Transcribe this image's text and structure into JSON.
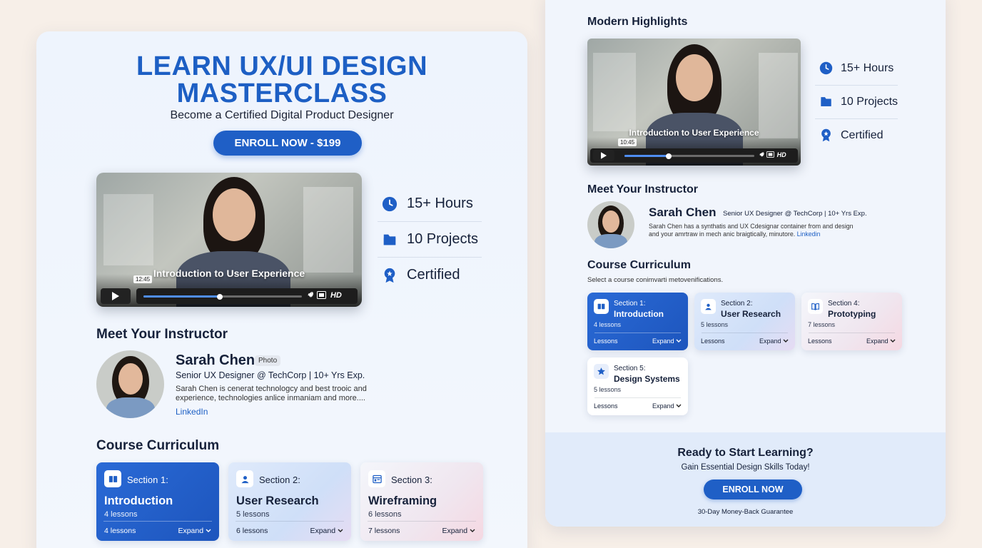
{
  "hero": {
    "title_line1": "LEARN UX/UI DESIGN",
    "title_line2": "MASTERCLASS",
    "subtitle": "Become a Certified Digital Product Designer",
    "enroll_label": "ENROLL NOW - $199"
  },
  "video": {
    "title": "Introduction to User Experience",
    "time": "12:45",
    "hd_label": "HD",
    "progress": 0.48
  },
  "stats": [
    {
      "icon": "clock-icon",
      "label": "15+ Hours"
    },
    {
      "icon": "folder-icon",
      "label": "10 Projects"
    },
    {
      "icon": "badge-icon",
      "label": "Certified"
    }
  ],
  "instructor": {
    "heading": "Meet Your Instructor",
    "name": "Sarah Chen",
    "photo_tag": "Photo",
    "role": "Senior UX Designer @ TechCorp | 10+ Yrs Exp.",
    "bio_line1": "Sarah Chen is cenerat technologcy and best trooic and",
    "bio_line2": "experience, technologies anlice inmaniam and more....",
    "link": "LinkedIn"
  },
  "curriculum": {
    "heading": "Course Curriculum",
    "sections": [
      {
        "section": "Section 1:",
        "title": "Introduction",
        "lessons": "4 lessons",
        "foot": "4 lessons",
        "expand": "Expand",
        "icon": "book-icon"
      },
      {
        "section": "Section 2:",
        "title": "User Research",
        "lessons": "5 lessons",
        "foot": "6 lessons",
        "expand": "Expand",
        "icon": "user-icon"
      },
      {
        "section": "Section 3:",
        "title": "Wireframing",
        "lessons": "6 lessons",
        "foot": "7 lessons",
        "expand": "Expand",
        "icon": "layout-icon"
      }
    ]
  },
  "right": {
    "highlights_heading": "Modern Highlights",
    "video": {
      "title": "Introduction to User Experience",
      "time": "10:45",
      "hd_label": "HD",
      "progress": 0.34
    },
    "stats": [
      {
        "icon": "clock-icon",
        "label": "15+ Hours"
      },
      {
        "icon": "folder-icon",
        "label": "10 Projects"
      },
      {
        "icon": "badge-icon",
        "label": "Certified"
      }
    ],
    "instructor": {
      "heading": "Meet Your Instructor",
      "name": "Sarah Chen",
      "role": "Senior UX Designer @ TechCorp | 10+ Yrs Exp.",
      "bio_line1": "Sarah Chen has a synthatis and UX Cdesignar container from and design",
      "bio_line2": "and your amrtraw in mech anic braigtically, minutore.",
      "link": "Linkedin"
    },
    "curriculum": {
      "heading": "Course Curriculum",
      "subtitle": "Select a course conimvarti metovenifications.",
      "sections": [
        {
          "section": "Section 1:",
          "title": "Introduction",
          "lessons": "4 lessons",
          "foot": "Lessons",
          "expand": "Expand",
          "icon": "book-icon"
        },
        {
          "section": "Section 2:",
          "title": "User Research",
          "lessons": "5 lessons",
          "foot": "Lessons",
          "expand": "Expand",
          "icon": "user-icon"
        },
        {
          "section": "Section 4:",
          "title": "Prototyping",
          "lessons": "7 lessons",
          "foot": "Lessons",
          "expand": "Expand",
          "icon": "book-open-icon"
        },
        {
          "section": "Section 5:",
          "title": "Design Systems",
          "lessons": "5 lessons",
          "foot": "Lessons",
          "expand": "Expand",
          "icon": "star-icon"
        }
      ]
    },
    "cta": {
      "heading": "Ready to Start Learning?",
      "subtitle": "Gain Essential Design Skills Today!",
      "button": "ENROLL NOW",
      "guarantee": "30-Day Money-Back Guarantee"
    }
  },
  "colors": {
    "accent": "#1f5fc6",
    "background": "#f7efe8",
    "panel": "#eef4fd"
  }
}
